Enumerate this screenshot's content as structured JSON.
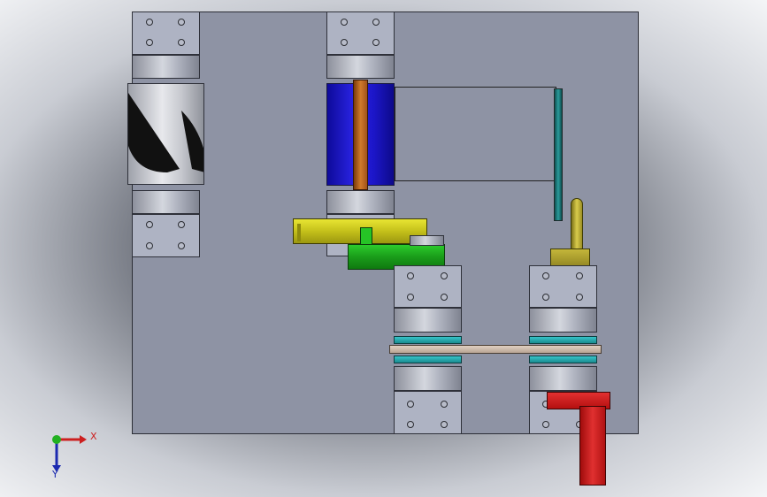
{
  "viewport": {
    "name": "cad-model-front-view"
  },
  "triad": {
    "x_label": "X",
    "y_label": "Y"
  },
  "colors": {
    "plate": "#8e93a4",
    "blue_roller": "#1c16c8",
    "orange_shaft": "#b8601a",
    "yellow_arm": "#d6d21c",
    "green_block": "#1fa51f",
    "olive_cam": "#a99a2c",
    "red_lever": "#cc1414",
    "teal_ring": "#1aa0a6",
    "tan_belt": "#c9b7a6"
  }
}
